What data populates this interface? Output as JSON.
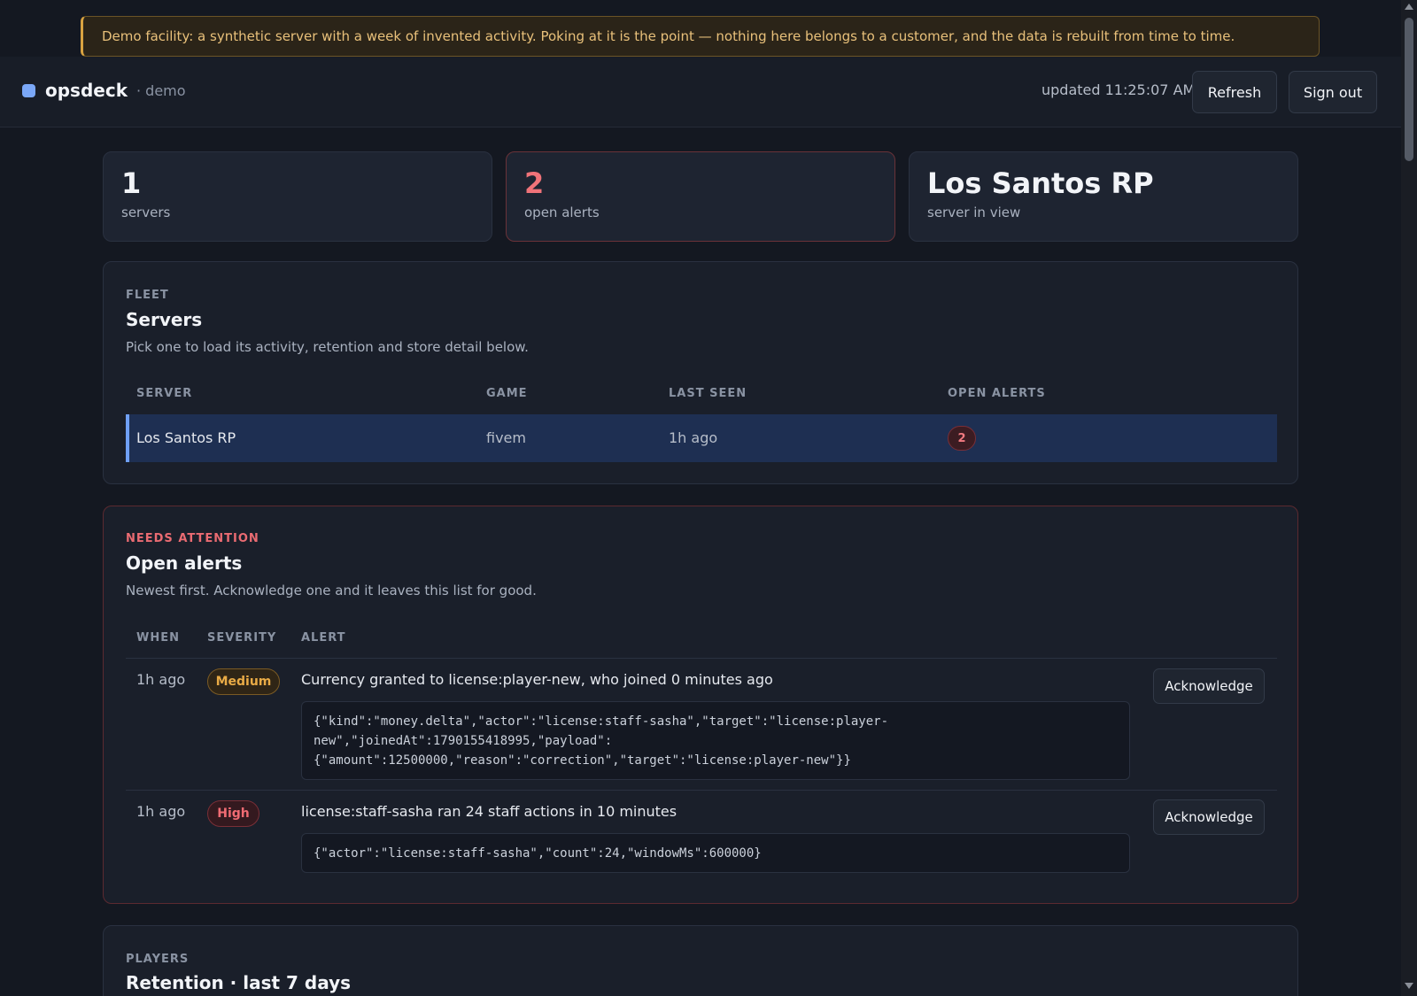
{
  "banner": {
    "text": "Demo facility: a synthetic server with a week of invented activity. Poking at it is the point — nothing here belongs to a customer, and the data is rebuilt from time to time."
  },
  "header": {
    "brand": "opsdeck",
    "env": "· demo",
    "updated": "updated 11:25:07 AM",
    "refresh_label": "Refresh",
    "signout_label": "Sign out"
  },
  "stats": [
    {
      "value": "1",
      "label": "servers"
    },
    {
      "value": "2",
      "label": "open alerts"
    },
    {
      "value": "Los Santos RP",
      "label": "server in view"
    }
  ],
  "fleet": {
    "eyebrow": "FLEET",
    "title": "Servers",
    "description": "Pick one to load its activity, retention and store detail below.",
    "columns": [
      "SERVER",
      "GAME",
      "LAST SEEN",
      "OPEN ALERTS"
    ],
    "rows": [
      {
        "server": "Los Santos RP",
        "game": "fivem",
        "last_seen": "1h ago",
        "open_alerts": "2"
      }
    ]
  },
  "alerts": {
    "eyebrow": "NEEDS ATTENTION",
    "title": "Open alerts",
    "description": "Newest first. Acknowledge one and it leaves this list for good.",
    "columns": [
      "WHEN",
      "SEVERITY",
      "ALERT"
    ],
    "ack_label": "Acknowledge",
    "rows": [
      {
        "when": "1h ago",
        "severity": "Medium",
        "message": "Currency granted to license:player-new, who joined 0 minutes ago",
        "payload": "{\"kind\":\"money.delta\",\"actor\":\"license:staff-sasha\",\"target\":\"license:player-\nnew\",\"joinedAt\":1790155418995,\"payload\":\n{\"amount\":12500000,\"reason\":\"correction\",\"target\":\"license:player-new\"}}"
      },
      {
        "when": "1h ago",
        "severity": "High",
        "message": "license:staff-sasha ran 24 staff actions in 10 minutes",
        "payload": "{\"actor\":\"license:staff-sasha\",\"count\":24,\"windowMs\":600000}"
      }
    ]
  },
  "players": {
    "eyebrow": "PLAYERS",
    "title": "Retention · last 7 days"
  },
  "colors": {
    "accent": "#7aa7f7",
    "danger": "#f07379",
    "warning": "#e9ab46"
  }
}
